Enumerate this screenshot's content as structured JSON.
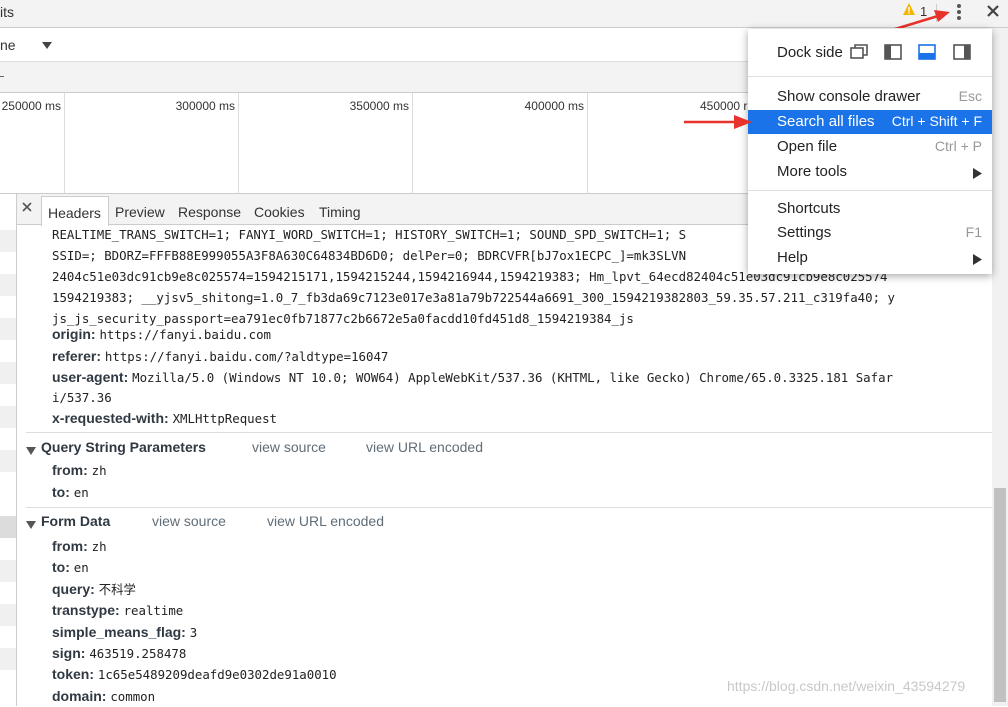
{
  "topbar": {
    "title_fragment": "its",
    "warning_count": "1"
  },
  "filter_row": {
    "select_fragment": "ne"
  },
  "timeline": {
    "ticks": [
      "250000 ms",
      "300000 ms",
      "350000 ms",
      "400000 ms",
      "450000 r"
    ]
  },
  "tabs": [
    "Headers",
    "Preview",
    "Response",
    "Cookies",
    "Timing"
  ],
  "headers": {
    "cookie_lines": [
      "REALTIME_TRANS_SWITCH=1; FANYI_WORD_SWITCH=1; HISTORY_SWITCH=1; SOUND_SPD_SWITCH=1; S",
      "SSID=; BDORZ=FFFB88E999055A3F8A630C64834BD6D0; delPer=0; BDRCVFR[bJ7ox1ECPC_]=mk3SLVN",
      "2404c51e03dc91cb9e8c025574=1594215171,1594215244,1594216944,1594219383; Hm_lpvt_64ecd82404c51e03dc91cb9e8c025574",
      "1594219383; __yjsv5_shitong=1.0_7_fb3da69c7123e017e3a81a79b722544a6691_300_1594219382803_59.35.57.211_c319fa40; y",
      "js_js_security_passport=ea791ec0fb71877c2b6672e5a0facdd10fd451d8_1594219384_js"
    ],
    "origin_key": "origin:",
    "origin_val": "https://fanyi.baidu.com",
    "referer_key": "referer:",
    "referer_val": "https://fanyi.baidu.com/?aldtype=16047",
    "ua_key": "user-agent:",
    "ua_val": "Mozilla/5.0 (Windows NT 10.0; WOW64) AppleWebKit/537.36 (KHTML, like Gecko) Chrome/65.0.3325.181 Safar",
    "ua_val2": "i/537.36",
    "xrw_key": "x-requested-with:",
    "xrw_val": "XMLHttpRequest"
  },
  "query_string": {
    "title": "Query String Parameters",
    "view_source": "view source",
    "view_url": "view URL encoded",
    "from_key": "from:",
    "from_val": "zh",
    "to_key": "to:",
    "to_val": "en"
  },
  "form_data": {
    "title": "Form Data",
    "view_source": "view source",
    "view_url": "view URL encoded",
    "rows": [
      {
        "k": "from:",
        "v": "zh"
      },
      {
        "k": "to:",
        "v": "en"
      },
      {
        "k": "query:",
        "v": "不科学"
      },
      {
        "k": "transtype:",
        "v": "realtime"
      },
      {
        "k": "simple_means_flag:",
        "v": "3"
      },
      {
        "k": "sign:",
        "v": "463519.258478"
      },
      {
        "k": "token:",
        "v": "1c65e5489209deafd9e0302de91a0010"
      },
      {
        "k": "domain:",
        "v": "common"
      }
    ]
  },
  "menu": {
    "dock_side": "Dock side",
    "show_console": "Show console drawer",
    "show_console_sc": "Esc",
    "search_all": "Search all files",
    "search_all_sc": "Ctrl + Shift + F",
    "open_file": "Open file",
    "open_file_sc": "Ctrl + P",
    "more_tools": "More tools",
    "shortcuts": "Shortcuts",
    "settings": "Settings",
    "settings_sc": "F1",
    "help": "Help"
  },
  "watermark": "https://blog.csdn.net/weixin_43594279",
  "colors": {
    "highlight": "#1a73e8",
    "arrow": "#e8322b",
    "warning": "#f4b400"
  }
}
